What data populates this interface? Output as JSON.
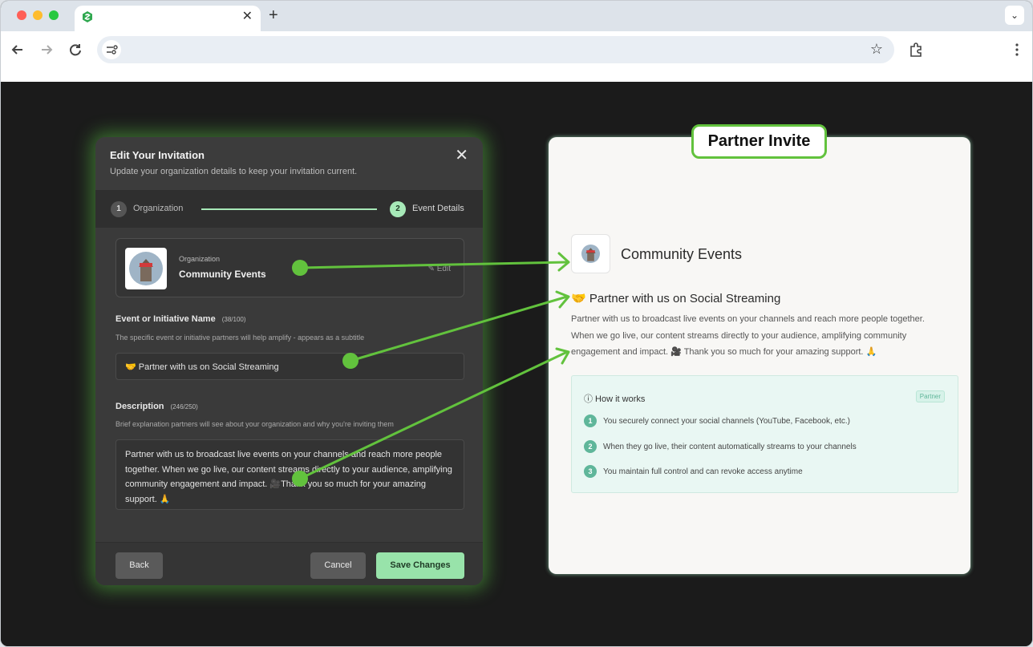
{
  "browser": {
    "tab_title": "",
    "tab_close": "✕",
    "new_tab": "+",
    "tab_menu": "⌄",
    "nav_icons": [
      "back-icon",
      "forward-icon",
      "reload-icon"
    ],
    "star": "☆"
  },
  "modal": {
    "title": "Edit Your Invitation",
    "subtitle": "Update your organization details to keep your invitation current.",
    "close": "✕",
    "steps": [
      {
        "num": "1",
        "label": "Organization"
      },
      {
        "num": "2",
        "label": "Event Details"
      }
    ],
    "org": {
      "caption": "Organization",
      "name": "Community Events",
      "edit": "✎ Edit"
    },
    "event_name": {
      "label": "Event or Initiative Name",
      "count": "(38/100)",
      "help": "The specific event or initiative partners will help amplify - appears as a subtitle",
      "value": "🤝 Partner with us on Social Streaming"
    },
    "description": {
      "label": "Description",
      "count": "(246/250)",
      "help": "Brief explanation partners will see about your organization and why you're inviting them",
      "value": "Partner with us to broadcast live events on your channels and reach more people together. When we go live, our content streams directly to your audience, amplifying community engagement and impact. 🎥Thank you so much for your amazing support. 🙏"
    },
    "buttons": {
      "back": "Back",
      "cancel": "Cancel",
      "save": "Save Changes"
    }
  },
  "callout": "Partner Invite",
  "preview": {
    "org_name": "Community Events",
    "title": "🤝 Partner with us on Social Streaming",
    "description": "Partner with us to broadcast live events on your channels and reach more people together. When we go live, our content streams directly to your audience, amplifying community engagement and impact. 🎥 Thank you so much for your amazing support. 🙏",
    "how": {
      "title": "ⓘ How it works",
      "badge": "Partner",
      "steps": [
        {
          "num": "1",
          "text": "You securely connect your social channels (YouTube, Facebook, etc.)"
        },
        {
          "num": "2",
          "text": "When they go live, their content automatically streams to your channels"
        },
        {
          "num": "3",
          "text": "You maintain full control and can revoke access anytime"
        }
      ]
    }
  },
  "colors": {
    "accent_green": "#62c23d",
    "step_green": "#a7e9b8",
    "save_button": "#98e3aa",
    "how_number": "#5fb69a"
  }
}
